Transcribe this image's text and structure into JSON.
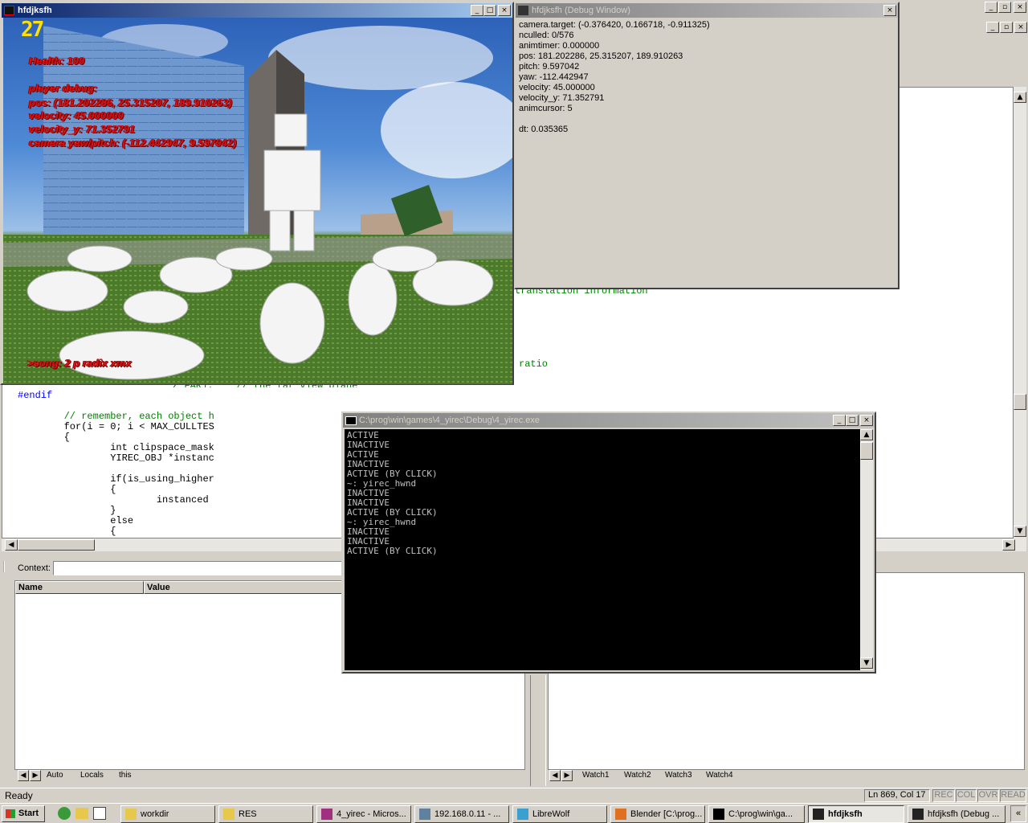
{
  "game": {
    "title": "hfdjksfh",
    "fps": "27",
    "health": "Health: 100",
    "debug_head": "player debug:",
    "pos": "pos: (181.202286, 25.315207, 189.910263)",
    "velocity": "velocity: 45.000000",
    "velocity_y": "velocity_y: 71.352791",
    "camera": "camera yaw/pitch: (-112.442947, 9.597042)",
    "song": ">song: 2 p radix xmx",
    "min": "_",
    "max": "□",
    "close": "×"
  },
  "debug": {
    "title": "hfdjksfh (Debug Window)",
    "lines": [
      "camera.target: (-0.376420, 0.166718, -0.911325)",
      "nculled: 0/576",
      "animtimer: 0.000000",
      "pos: 181.202286, 25.315207, 189.910263",
      "pitch: 9.597042",
      "yaw: -112.442947",
      "velocity: 45.000000",
      "velocity_y: 71.352791",
      "animcursor: 5",
      "",
      "dt: 0.035365"
    ],
    "close": "×"
  },
  "code": {
    "frag1": "translation information",
    "frag2": "ratio",
    "frag3": "Z_FAR);    // the far view plane",
    "lines": [
      "#endif",
      "",
      "        // remember, each object h",
      "        for(i = 0; i < MAX_CULLTES",
      "        {",
      "                int clipspace_mask",
      "                YIREC_OBJ *instanc",
      "",
      "                if(is_using_higher",
      "                {",
      "                        instanced",
      "                }",
      "                else",
      "                {"
    ]
  },
  "console": {
    "title": "C:\\prog\\win\\games\\4_yirec\\Debug\\4_yirec.exe",
    "lines": [
      "ACTIVE",
      "INACTIVE",
      "ACTIVE",
      "INACTIVE",
      "ACTIVE (BY CLICK)",
      "~: yirec_hwnd",
      "INACTIVE",
      "INACTIVE",
      "ACTIVE (BY CLICK)",
      "~: yirec_hwnd",
      "INACTIVE",
      "INACTIVE",
      "ACTIVE (BY CLICK)"
    ]
  },
  "vars": {
    "context_label": "Context:",
    "col_name": "Name",
    "col_value": "Value",
    "tabs": [
      "Auto",
      "Locals",
      "this"
    ]
  },
  "watch": {
    "tabs": [
      "Watch1",
      "Watch2",
      "Watch3",
      "Watch4"
    ]
  },
  "status": {
    "ready": "Ready",
    "pos": "Ln 869, Col 17",
    "rec": "REC",
    "col": "COL",
    "ovr": "OVR",
    "read": "READ"
  },
  "taskbar": {
    "start": "Start",
    "buttons": [
      {
        "label": "workdir",
        "icon": "folder-icon"
      },
      {
        "label": "RES",
        "icon": "folder-icon"
      },
      {
        "label": "4_yirec - Micros...",
        "icon": "devstudio-icon"
      },
      {
        "label": "192.168.0.11 - ...",
        "icon": "remote-icon"
      },
      {
        "label": "LibreWolf",
        "icon": "browser-icon"
      },
      {
        "label": "Blender [C:\\prog...",
        "icon": "blender-icon"
      },
      {
        "label": "C:\\prog\\win\\ga...",
        "icon": "console-icon"
      },
      {
        "label": "hfdjksfh",
        "icon": "app-icon"
      },
      {
        "label": "hfdjksfh (Debug ...",
        "icon": "app-icon"
      }
    ]
  },
  "colors": {
    "title_active": "#0a246a",
    "hud": "#e01010",
    "console_bg": "#000000",
    "sky": "#3a74c8",
    "grass": "#4b7a2a"
  }
}
